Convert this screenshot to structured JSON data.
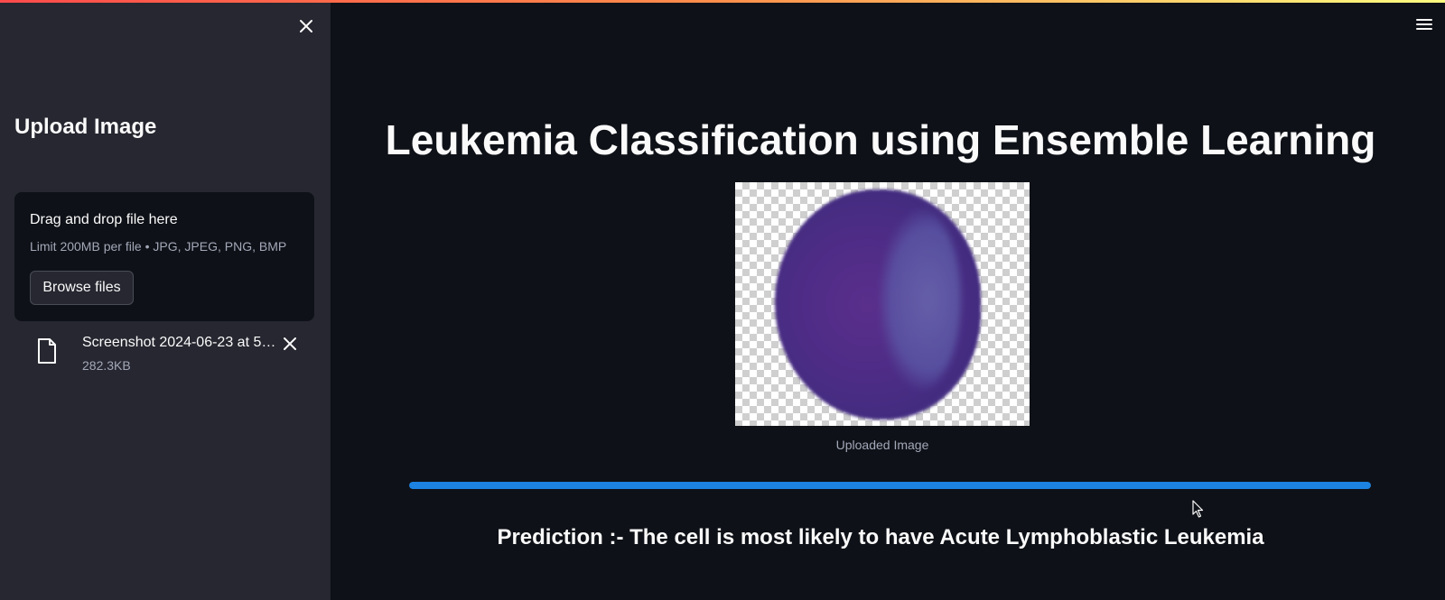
{
  "sidebar": {
    "title": "Upload Image",
    "uploader": {
      "drop_label": "Drag and drop file here",
      "limit_text": "Limit 200MB per file • JPG, JPEG, PNG, BMP",
      "browse_label": "Browse files"
    },
    "file": {
      "name": "Screenshot 2024-06-23 at 5.…",
      "size": "282.3KB"
    }
  },
  "main": {
    "title": "Leukemia Classification using Ensemble Learning",
    "image_caption": "Uploaded Image",
    "progress_percent": 100,
    "prediction": "Prediction :- The cell is most likely to have Acute Lymphoblastic Leukemia"
  },
  "icons": {
    "sidebar_close": "close-icon",
    "file": "file-icon",
    "file_remove": "close-icon",
    "menu": "hamburger-menu-icon"
  },
  "colors": {
    "background": "#0e1117",
    "sidebar": "#262730",
    "progress": "#1c83e1",
    "text": "#fafafa",
    "muted_text": "#a3a8b8"
  }
}
